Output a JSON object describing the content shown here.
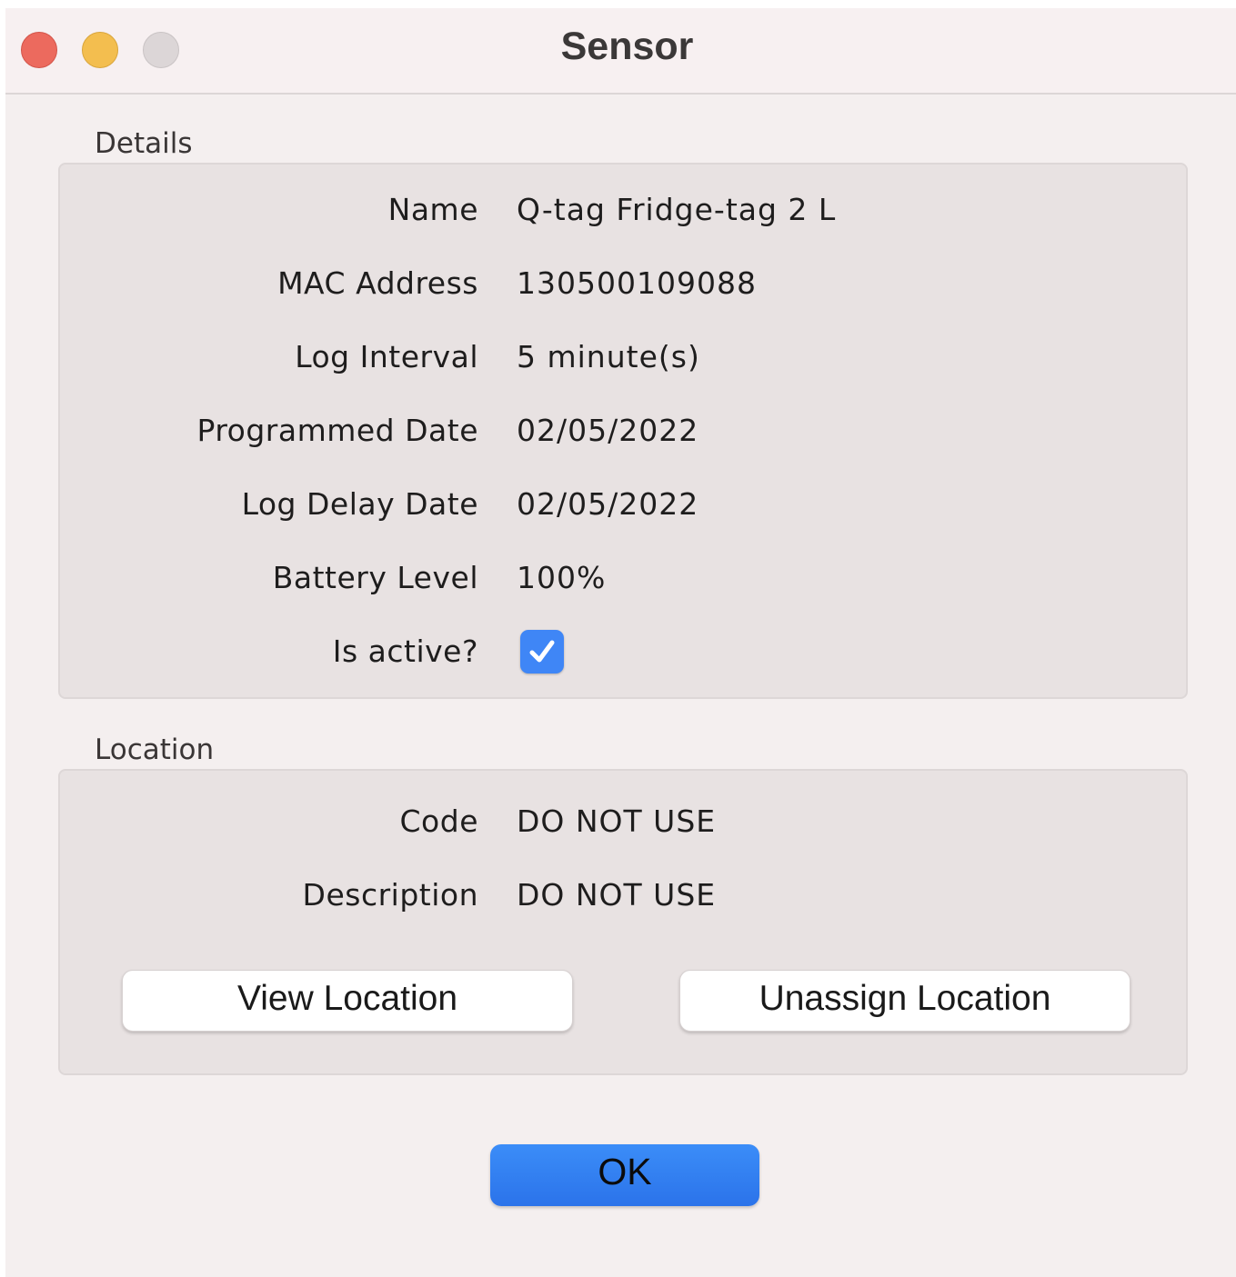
{
  "window": {
    "title": "Sensor"
  },
  "details": {
    "group_label": "Details",
    "rows": [
      {
        "label": "Name",
        "value": "Q-tag Fridge-tag 2 L"
      },
      {
        "label": "MAC Address",
        "value": "130500109088"
      },
      {
        "label": "Log Interval",
        "value": "5 minute(s)"
      },
      {
        "label": "Programmed Date",
        "value": "02/05/2022"
      },
      {
        "label": "Log Delay Date",
        "value": "02/05/2022"
      },
      {
        "label": "Battery Level",
        "value": "100%"
      }
    ],
    "active": {
      "label": "Is active?",
      "checked": true
    }
  },
  "location": {
    "group_label": "Location",
    "rows": [
      {
        "label": "Code",
        "value": "DO NOT USE"
      },
      {
        "label": "Description",
        "value": "DO NOT USE"
      }
    ],
    "view_button": "View Location",
    "unassign_button": "Unassign Location"
  },
  "footer": {
    "ok_button": "OK"
  },
  "colors": {
    "accent": "#3f86f6",
    "close": "#ec6a5e",
    "minimize": "#f3be4f",
    "zoom": "#dcd6d7"
  }
}
